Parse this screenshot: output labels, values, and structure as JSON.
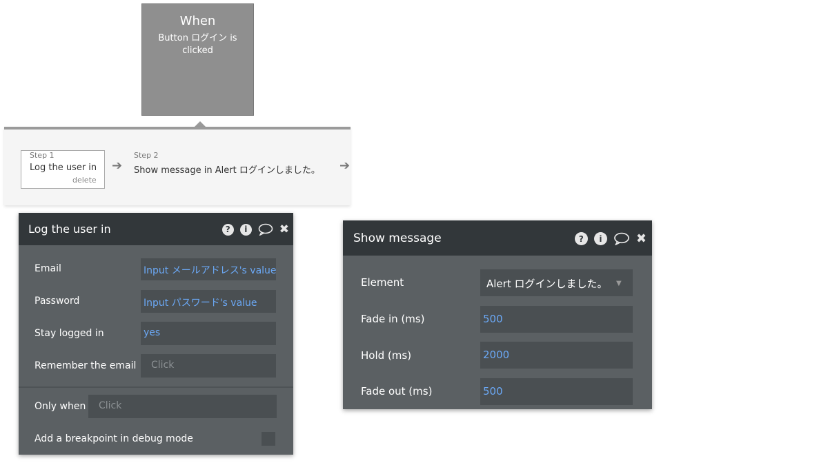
{
  "trigger": {
    "title": "When",
    "subtitle": "Button ログイン is clicked"
  },
  "steps": [
    {
      "number": "Step 1",
      "label": "Log the user in",
      "delete_label": "delete"
    },
    {
      "number": "Step 2",
      "label": "Show message in Alert ログインしました。"
    }
  ],
  "login_panel": {
    "title": "Log the user in",
    "fields": [
      {
        "label": "Email",
        "value": "Input メールアドレス's value"
      },
      {
        "label": "Password",
        "value": "Input パスワード's value"
      },
      {
        "label": "Stay logged in",
        "value": "yes"
      },
      {
        "label": "Remember the email",
        "value": "Click"
      }
    ],
    "only_when": {
      "label": "Only when",
      "value": "Click"
    },
    "breakpoint_label": "Add a breakpoint in debug mode"
  },
  "message_panel": {
    "title": "Show message",
    "fields": [
      {
        "label": "Element",
        "value": "Alert ログインしました。"
      },
      {
        "label": "Fade in (ms)",
        "value": "500"
      },
      {
        "label": "Hold (ms)",
        "value": "2000"
      },
      {
        "label": "Fade out (ms)",
        "value": "500"
      }
    ]
  },
  "icons": [
    "help-icon",
    "info-icon",
    "comment-icon",
    "close-icon"
  ],
  "colors": {
    "panel_header": "#32373a",
    "panel_body": "#5b6063",
    "field_bg": "#4a4f52",
    "link_blue": "#6ba8f5",
    "trigger_box": "#8f8f8f"
  }
}
